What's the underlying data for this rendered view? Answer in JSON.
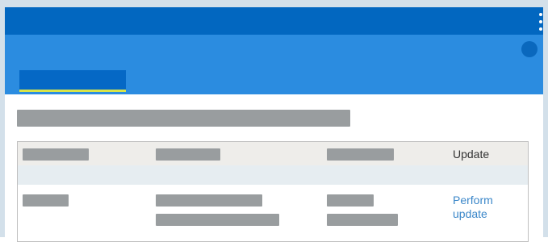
{
  "table": {
    "header": {
      "update_label": "Update"
    },
    "rows": [
      {
        "action_label": "Perform update"
      }
    ]
  },
  "colors": {
    "app_bar": "#0267c0",
    "banner": "#2b8ce0",
    "active_tab": "#0568c5",
    "tab_indicator": "#d8e44a",
    "link": "#3b87c9",
    "placeholder": "#999d9f"
  },
  "icons": {
    "menu": "kebab-menu-icon",
    "avatar": "avatar"
  }
}
